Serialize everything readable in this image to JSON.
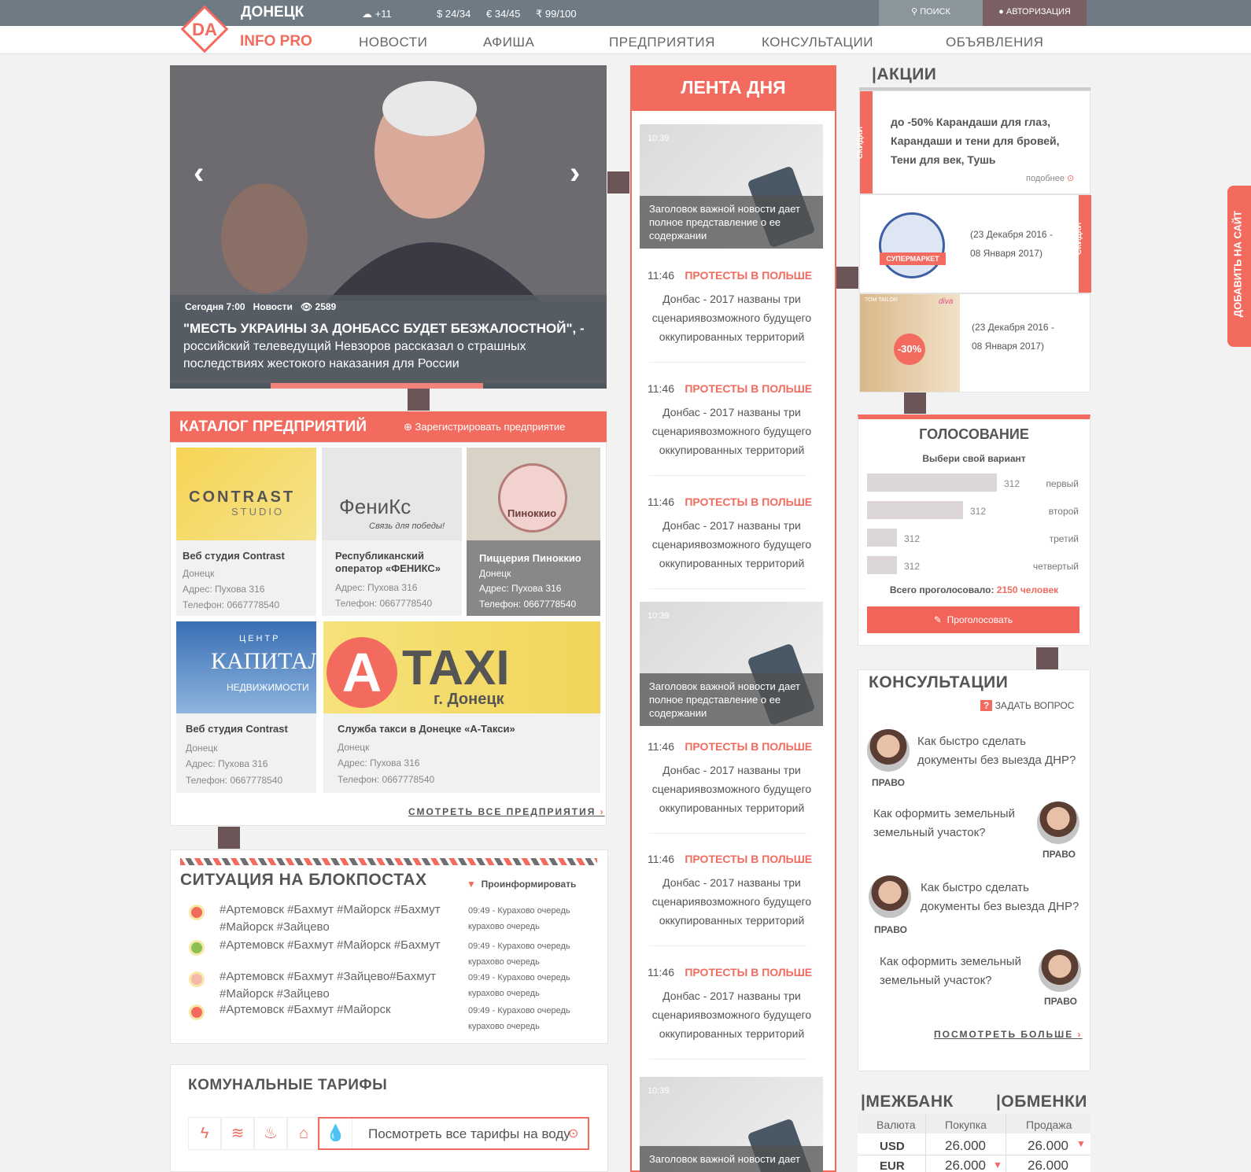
{
  "header": {
    "city": "ДОНЕЦК",
    "weather": "+11",
    "usd": "$ 24/34",
    "eur": "€ 34/45",
    "rub": "₹ 99/100",
    "search": "ПОИСК",
    "auth": "АВТОРИЗАЦИЯ",
    "brand": "INFO PRO",
    "logo_text": "DA",
    "nav": [
      "НОВОСТИ",
      "АФИША",
      "ПРЕДПРИЯТИЯ",
      "КОНСУЛЬТАЦИИ",
      "ОБЪЯВЛЕНИЯ"
    ]
  },
  "hero": {
    "date": "Сегодня 7:00",
    "category": "Новости",
    "views": "2589",
    "headline": "\"МЕСТЬ УКРАИНЫ ЗА ДОНБАСС БУДЕТ БЕЗЖАЛОСТНОЙ\", -",
    "sub": "российский телеведущий Невзоров рассказал о страшных последствиях жестокого наказания для России"
  },
  "catalog": {
    "title": "КАТАЛОГ ПРЕДПРИЯТИЙ",
    "register": "Зарегистрировать предприятие",
    "see_all": "СМОТРЕТЬ ВСЕ ПРЕДПРИЯТИЯ",
    "items": [
      {
        "logo": "CONTRAST",
        "logo2": "STUDIO",
        "name": "Веб студия Contrast",
        "city": "Донецк",
        "address": "Адрес: Пухова 316",
        "phone": "Телефон: 0667778540"
      },
      {
        "logo": "ФениКс",
        "logo2": "Связь для победы!",
        "name": "Республиканский оператор «ФЕНИКС»",
        "address": "Адрес: Пухова 316",
        "phone": "Телефон: 0667778540"
      },
      {
        "logo": "Пиноккио",
        "name": "Пиццерия Пиноккио",
        "city": "Донецк",
        "address": "Адрес: Пухова 316",
        "phone": "Телефон: 0667778540"
      },
      {
        "logo": "КАПИТАЛ",
        "logo0": "ЦЕНТР",
        "logo2": "НЕДВИЖИМОСТИ",
        "name": "Веб студия Contrast",
        "city": "Донецк",
        "address": "Адрес: Пухова 316",
        "phone": "Телефон: 0667778540"
      },
      {
        "logo": "TAXI",
        "logo2": "г. Донецк",
        "name": "Служба такси в Донецке «А-Такси»",
        "city": "Донецк",
        "address": "Адрес: Пухова 316",
        "phone": "Телефон: 0667778540"
      }
    ]
  },
  "checkpoints": {
    "title": "СИТУАЦИЯ НА БЛОКПОСТАХ",
    "inform": "Проинформировать",
    "rows": [
      {
        "color": "#f26b5e",
        "tags": "#Артемовск #Бахмут #Майорск #Бахмут #Майорск #Зайцево",
        "time": "09:49",
        "note": "Курахово очередь",
        "note2": "курахово очередь"
      },
      {
        "color": "#8cc152",
        "tags": "#Артемовск #Бахмут #Майорск #Бахмут",
        "time": "09:49",
        "note": "Курахово очередь",
        "note2": "курахово очередь"
      },
      {
        "color": "#f6b9a9",
        "tags": "#Артемовск #Бахмут #Зайцево#Бахмут #Майорск #Зайцево",
        "time": "09:49",
        "note": "Курахово очередь",
        "note2": "курахово очередь"
      },
      {
        "color": "#f26b5e",
        "tags": "#Артемовск #Бахмут #Майорск",
        "time": "09:49",
        "note": "Курахово очередь",
        "note2": "курахово очередь"
      }
    ]
  },
  "tariffs": {
    "title": "КОМУНАЛЬНЫЕ ТАРИФЫ",
    "water_link": "Посмотреть все тарифы на воду"
  },
  "feed": {
    "title": "ЛЕНТА ДНЯ",
    "img_time": "10:39",
    "img_caption": "Заголовок важной новости дает полное представление о ее содержании",
    "img_caption_short": "Заголовок важной новости дает",
    "time": "11:46",
    "tag": "ПРОТЕСТЫ В ПОЛЬШЕ",
    "text": "Донбас - 2017 названы три сценариявозможного будущего оккупированных территорий"
  },
  "promos": {
    "title": "АКЦИИ",
    "tag": "СКИДКИ",
    "text": "до -50% Карандаши  для глаз, Карандаши и тени для бровей, Тени для век, Тушь",
    "more": "подобнее",
    "market": "СУПЕРМАРКЕТ",
    "date": "(23 Декабря 2016 - 08 Января 2017)",
    "discount": "-30%",
    "brand": "TOM TAILOR",
    "brand2": "diva"
  },
  "voting": {
    "title": "ГОЛОСОВАНИЕ",
    "subtitle": "Выбери свой вариант",
    "total_label": "Всего проголосовало:",
    "total": "2150 человек",
    "button": "Проголосовать",
    "options": [
      {
        "count": "312",
        "label": "первый",
        "fraction": 1.0
      },
      {
        "count": "312",
        "label": "второй",
        "fraction": 0.74
      },
      {
        "count": "312",
        "label": "третий",
        "fraction": 0.23
      },
      {
        "count": "312",
        "label": "четвертый",
        "fraction": 0.23
      }
    ]
  },
  "consult": {
    "title": "КОНСУЛЬТАЦИИ",
    "ask": "ЗАДАТЬ ВОПРОС",
    "more": "ПОСМОТРЕТЬ БОЛЬШЕ",
    "items": [
      {
        "q": "Как быстро сделать документы без выезда ДНР?",
        "tag": "ПРАВО"
      },
      {
        "q": "Как оформить земельный земельный участок?",
        "tag": "ПРАВО"
      },
      {
        "q": "Как быстро сделать документы без выезда ДНР?",
        "tag": "ПРАВО"
      },
      {
        "q": "Как оформить земельный земельный участок?",
        "tag": "ПРАВО"
      }
    ]
  },
  "exchange": {
    "title1": "МЕЖБАНК",
    "title2": "ОБМЕНКИ",
    "col": [
      "Валюта",
      "Покупка",
      "Продажа"
    ],
    "rows": [
      {
        "cur": "USD",
        "buy": "26.000",
        "sell": "26.000"
      },
      {
        "cur": "EUR",
        "buy": "26.000",
        "sell": "26.000"
      }
    ]
  },
  "side_tab": "ДОБАВИТЬ НА САЙТ",
  "colors": {
    "accent": "#f26b5e",
    "topbar": "#6f7b84",
    "connector": "#6b5557"
  }
}
